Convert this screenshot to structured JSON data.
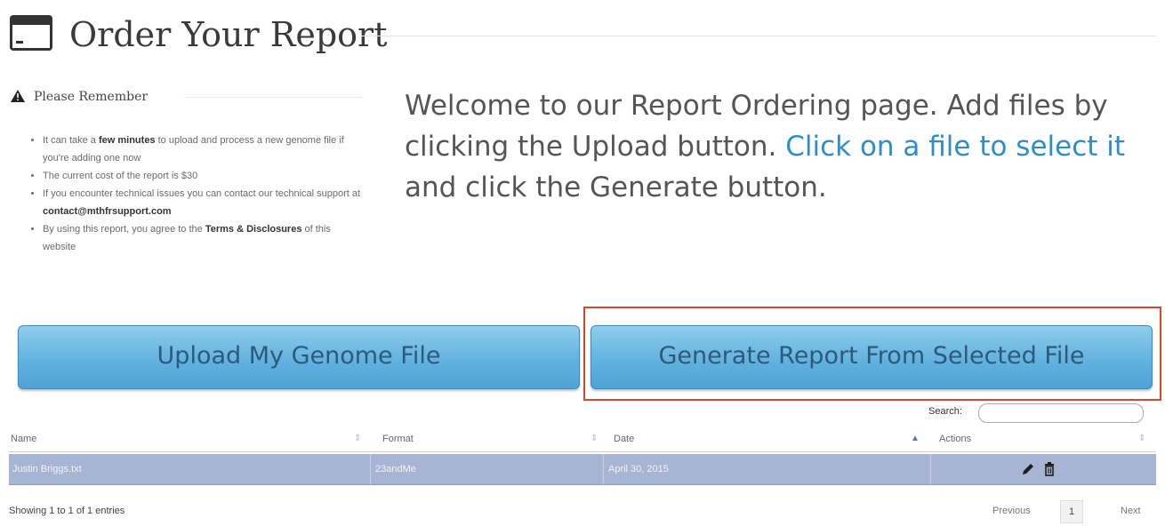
{
  "header": {
    "title": "Order Your Report",
    "icon": "credit-card-icon"
  },
  "reminder": {
    "heading": "Please Remember",
    "items": [
      {
        "pre": "It can take a ",
        "bold": "few minutes",
        "post": " to upload and process a new genome file if you're adding one now"
      },
      {
        "pre": "The current cost of the report is $30",
        "bold": "",
        "post": ""
      },
      {
        "pre": "If you encounter technical issues you can contact our technical support at ",
        "bold": "contact@mthfrsupport.com",
        "post": ""
      },
      {
        "pre": "By using this report, you agree to the ",
        "bold": "Terms & Disclosures",
        "post": " of this website"
      }
    ]
  },
  "welcome": {
    "text_before": "Welcome to our Report Ordering page. Add files by clicking the Upload button. ",
    "link_text": "Click on a file to select it",
    "text_after": " and click the Generate button.",
    "link_color": "#2e8fc8"
  },
  "buttons": {
    "upload": "Upload My Genome File",
    "generate": "Generate Report From Selected File"
  },
  "table": {
    "search_label": "Search:",
    "search_value": "",
    "columns": [
      "Name",
      "Format",
      "Date",
      "Actions"
    ],
    "sorted_column": "Date",
    "rows": [
      {
        "name": "Justin Briggs.txt",
        "format": "23andMe",
        "date": "April 30, 2015",
        "actions": [
          "pencil-icon",
          "trash-icon"
        ]
      }
    ],
    "selected_row_color": "#a8b4d3"
  },
  "footer": {
    "info": "Showing 1 to 1 of 1 entries",
    "previous": "Previous",
    "current_page": "1",
    "next": "Next"
  },
  "colors": {
    "button": "#5fb0de",
    "highlight_border": "#d8472b"
  }
}
